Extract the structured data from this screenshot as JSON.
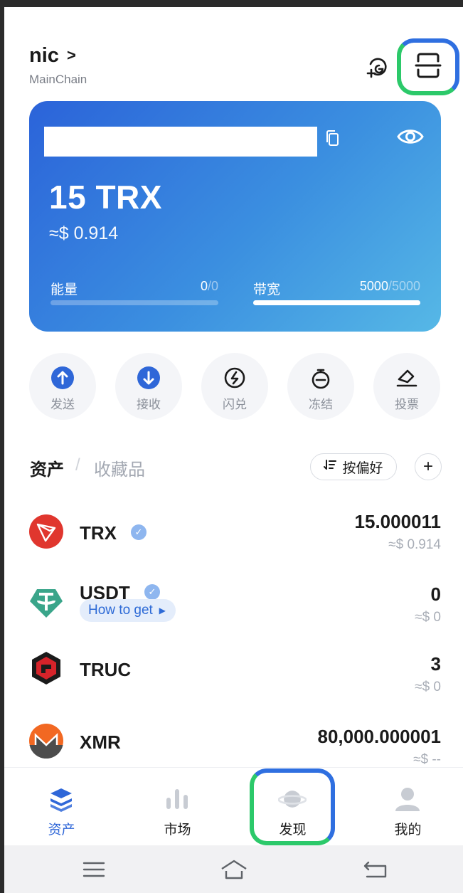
{
  "header": {
    "wallet_name": "nic",
    "wallet_chevron": ">",
    "chain": "MainChain"
  },
  "card": {
    "balance": "15 TRX",
    "balance_usd": "≈$ 0.914",
    "energy": {
      "label": "能量",
      "used": "0",
      "total": "/0",
      "fill": 0
    },
    "bandwidth": {
      "label": "带宽",
      "used": "5000",
      "total": "/5000",
      "fill": 1.0
    }
  },
  "actions": [
    {
      "label": "发送",
      "icon": "arrow-up-icon"
    },
    {
      "label": "接收",
      "icon": "arrow-down-icon"
    },
    {
      "label": "闪兑",
      "icon": "swap-icon"
    },
    {
      "label": "冻结",
      "icon": "freeze-icon"
    },
    {
      "label": "投票",
      "icon": "vote-icon"
    }
  ],
  "asset_tabs": {
    "assets": "资产",
    "separator": "/",
    "collectibles": "收藏品",
    "sort_label": "按偏好",
    "add": "+"
  },
  "tokens": [
    {
      "symbol": "TRX",
      "amount": "15.000011",
      "usd": "≈$ 0.914",
      "verified": true,
      "color": "#e0362e"
    },
    {
      "symbol": "USDT",
      "amount": "0",
      "usd": "≈$ 0",
      "verified": true,
      "how_to_get": "How to get",
      "color": "#3aa58a"
    },
    {
      "symbol": "TRUC",
      "amount": "3",
      "usd": "≈$ 0",
      "verified": false,
      "color": "#d6232a"
    },
    {
      "symbol": "XMR",
      "amount": "80,000.000001",
      "usd": "≈$ --",
      "verified": false,
      "color": "#f26822"
    }
  ],
  "nav": [
    {
      "label": "资产",
      "icon": "wallet-stack-icon",
      "active": true
    },
    {
      "label": "市场",
      "icon": "market-chart-icon",
      "active": false
    },
    {
      "label": "发现",
      "icon": "planet-icon",
      "active": false
    },
    {
      "label": "我的",
      "icon": "profile-icon",
      "active": false
    }
  ],
  "colors": {
    "accent": "#2f67d8",
    "highlight_green": "#2cc96a",
    "highlight_blue": "#2f6fe0"
  }
}
